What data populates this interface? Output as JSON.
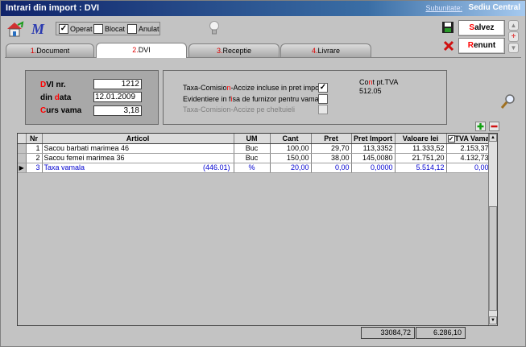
{
  "window": {
    "title": "Intrari din import : DVI",
    "subunit_label": "Subunitate:",
    "subunit_value": "Sediu Central"
  },
  "toolbar": {
    "checks": [
      {
        "label": "Operat",
        "checked": true
      },
      {
        "label": "Blocat",
        "checked": false
      },
      {
        "label": "Anulat",
        "checked": false
      }
    ],
    "save_hot": "S",
    "save_rest": "alvez",
    "cancel_hot": "R",
    "cancel_rest": "enunt"
  },
  "tabs": [
    {
      "num": "1.",
      "label": "Document",
      "active": false
    },
    {
      "num": "2.",
      "label": "DVI",
      "active": true
    },
    {
      "num": "3.",
      "label": "Receptie",
      "active": false
    },
    {
      "num": "4.",
      "label": "Livrare",
      "active": false
    }
  ],
  "dvi": {
    "nr_label_hot": "D",
    "nr_label_rest": "VI nr.",
    "nr_value": "1212",
    "data_label_a": "din ",
    "data_label_hot": "d",
    "data_label_b": "ata",
    "data_value": "12.01.2009",
    "curs_label_hot": "C",
    "curs_label_rest": "urs vama",
    "curs_value": "3,18"
  },
  "options": {
    "opt1_a": "Taxa-Comisio",
    "opt1_hot": "n",
    "opt1_b": "-Accize incluse in pret import",
    "opt1_checked": true,
    "opt2_a": "Evidentiere in f",
    "opt2_hot": "i",
    "opt2_b": "sa de furnizor pentru vama",
    "opt2_checked": false,
    "opt3": "Taxa-Comision-Accize pe cheltuieli",
    "opt3_checked": false,
    "cont_a": "Co",
    "cont_hot": "n",
    "cont_b": "t pt.TVA",
    "cont_value": "512.05"
  },
  "grid": {
    "columns": [
      "Nr",
      "Articol",
      "UM",
      "Cant",
      "Pret",
      "Pret Import",
      "Valoare lei",
      "TVA Vama"
    ],
    "tva_checked": true,
    "rows": [
      {
        "nr": "1",
        "articol": "Sacou barbati marimea 46",
        "extra": "",
        "um": "Buc",
        "cant": "100,00",
        "pret": "29,70",
        "pret_import": "113,3352",
        "valoare": "11.333,52",
        "tva": "2.153,37"
      },
      {
        "nr": "2",
        "articol": "Sacou femei marimea 36",
        "extra": "",
        "um": "Buc",
        "cant": "150,00",
        "pret": "38,00",
        "pret_import": "145,0080",
        "valoare": "21.751,20",
        "tva": "4.132,73"
      },
      {
        "nr": "3",
        "articol": "Taxa vamala",
        "extra": "(446.01)",
        "um": "%",
        "cant": "20,00",
        "pret": "0,00",
        "pret_import": "0,0000",
        "valoare": "5.514,12",
        "tva": "0,00"
      }
    ],
    "total_valoare": "33084,72",
    "total_tva": "6.286,10"
  }
}
